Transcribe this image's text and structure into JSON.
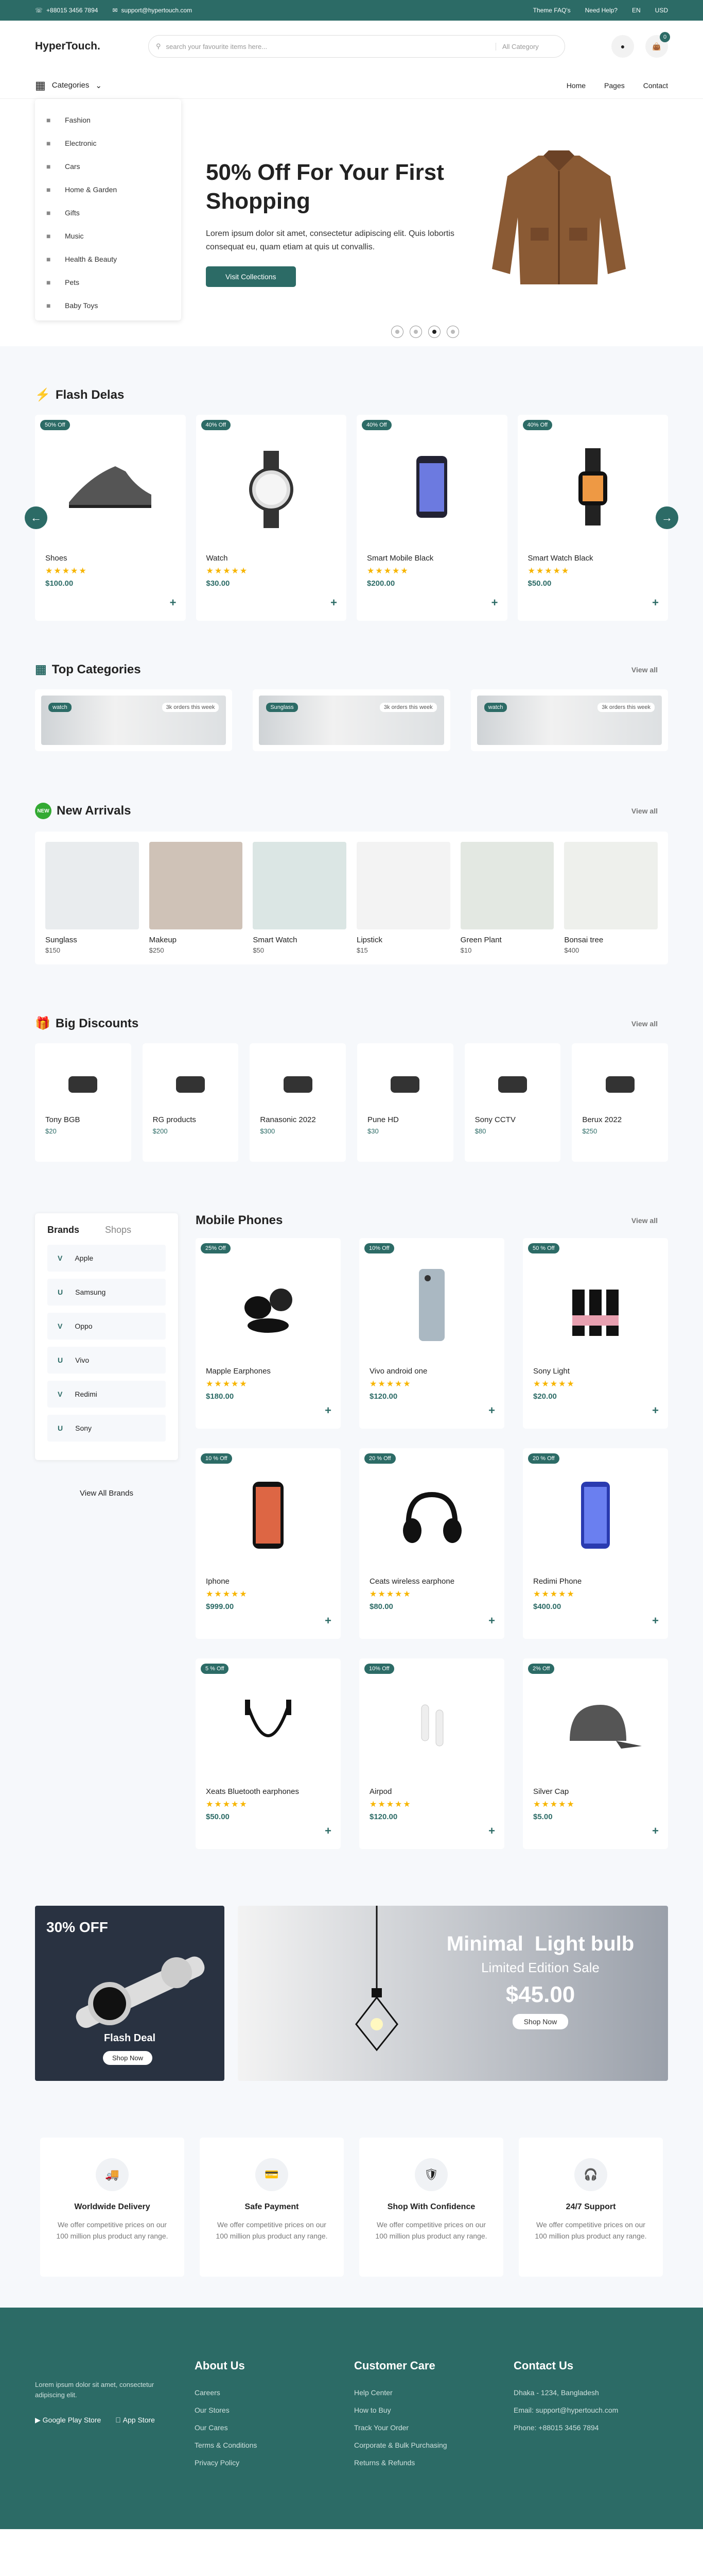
{
  "topbar": {
    "phone": "+88015 3456 7894",
    "email": "support@hypertouch.com",
    "faq": "Theme FAQ's",
    "help": "Need Help?",
    "lang": "EN",
    "currency": "USD"
  },
  "header": {
    "logo": "HyperTouch.",
    "search_placeholder": "search your favourite items here...",
    "search_category": "All Category",
    "cart_count": "0"
  },
  "nav": {
    "categories": "Categories",
    "links": [
      "Home",
      "Pages",
      "Contact"
    ]
  },
  "categories": [
    {
      "label": "Fashion",
      "icon": "shirt-icon"
    },
    {
      "label": "Electronic",
      "icon": "electronics-icon"
    },
    {
      "label": "Cars",
      "icon": "car-icon"
    },
    {
      "label": "Home & Garden",
      "icon": "home-icon"
    },
    {
      "label": "Gifts",
      "icon": "gift-icon"
    },
    {
      "label": "Music",
      "icon": "music-icon"
    },
    {
      "label": "Health & Beauty",
      "icon": "beauty-icon"
    },
    {
      "label": "Pets",
      "icon": "pet-icon"
    },
    {
      "label": "Baby Toys",
      "icon": "toy-icon"
    }
  ],
  "hero": {
    "title": "50% Off For Your First Shopping",
    "text": "Lorem ipsum dolor sit amet, consectetur adipiscing elit. Quis lobortis consequat eu, quam etiam at quis ut convallis.",
    "button": "Visit Collections",
    "active_slide": 3,
    "slides": 4
  },
  "flash": {
    "title": "Flash Delas",
    "items": [
      {
        "off": "50% Off",
        "name": "Shoes",
        "price": "$100.00",
        "img": "shoe"
      },
      {
        "off": "40% Off",
        "name": "Watch",
        "price": "$30.00",
        "img": "watch"
      },
      {
        "off": "40% Off",
        "name": "Smart Mobile Black",
        "price": "$200.00",
        "img": "phone"
      },
      {
        "off": "40% Off",
        "name": "Smart Watch Black",
        "price": "$50.00",
        "img": "smartwatch"
      }
    ]
  },
  "topcat": {
    "title": "Top Categories",
    "viewall": "View all",
    "items": [
      {
        "tag": "watch",
        "orders": "3k orders this week"
      },
      {
        "tag": "Sunglass",
        "orders": "3k orders this week"
      },
      {
        "tag": "watch",
        "orders": "3k orders this week"
      }
    ]
  },
  "arrivals": {
    "title": "New Arrivals",
    "viewall": "View all",
    "badge": "NEW",
    "items": [
      {
        "name": "Sunglass",
        "price": "$150"
      },
      {
        "name": "Makeup",
        "price": "$250"
      },
      {
        "name": "Smart Watch",
        "price": "$50"
      },
      {
        "name": "Lipstick",
        "price": "$15"
      },
      {
        "name": "Green Plant",
        "price": "$10"
      },
      {
        "name": "Bonsai tree",
        "price": "$400"
      }
    ]
  },
  "discounts": {
    "title": "Big Discounts",
    "viewall": "View all",
    "items": [
      {
        "name": "Tony BGB",
        "price": "$20"
      },
      {
        "name": "RG products",
        "price": "$200"
      },
      {
        "name": "Ranasonic 2022",
        "price": "$300"
      },
      {
        "name": "Pune HD",
        "price": "$30"
      },
      {
        "name": "Sony CCTV",
        "price": "$80"
      },
      {
        "name": "Berux 2022",
        "price": "$250"
      }
    ]
  },
  "brands": {
    "tab1": "Brands",
    "tab2": "Shops",
    "items": [
      "Apple",
      "Samsung",
      "Oppo",
      "Vivo",
      "Redimi",
      "Sony"
    ],
    "viewall": "View All Brands"
  },
  "mobile": {
    "title": "Mobile Phones",
    "viewall": "View all",
    "items": [
      {
        "off": "25% Off",
        "name": "Mapple Earphones",
        "price": "$180.00",
        "img": "earbuds"
      },
      {
        "off": "10% Off",
        "name": "Vivo android one",
        "price": "$120.00",
        "img": "silverphone"
      },
      {
        "off": "50 % Off",
        "name": "Sony Light",
        "price": "$20.00",
        "img": "bottles"
      },
      {
        "off": "10 % Off",
        "name": "Iphone",
        "price": "$999.00",
        "img": "iphone"
      },
      {
        "off": "20 % Off",
        "name": "Ceats wireless earphone",
        "price": "$80.00",
        "img": "earbuds2"
      },
      {
        "off": "20 % Off",
        "name": "Redimi Phone",
        "price": "$400.00",
        "img": "bluephone"
      },
      {
        "off": "5 % Off",
        "name": "Xeats Bluetooth earphones",
        "price": "$50.00",
        "img": "neckband"
      },
      {
        "off": "10% Off",
        "name": "Airpod",
        "price": "$120.00",
        "img": "airpod"
      },
      {
        "off": "2% Off",
        "name": "Silver Cap",
        "price": "$5.00",
        "img": "cap"
      }
    ]
  },
  "promo1": {
    "off": "30% OFF",
    "title": "Flash Deal",
    "button": "Shop Now"
  },
  "promo2": {
    "title": "Minimal  Light bulb",
    "subtitle": "Limited Edition Sale",
    "price": "$45.00",
    "button": "Shop Now"
  },
  "features": [
    {
      "title": "Worldwide Delivery",
      "text": "We offer competitive prices on our 100 million plus product any range.",
      "icon": "truck-icon"
    },
    {
      "title": "Safe Payment",
      "text": "We offer competitive prices on our 100 million plus product any range.",
      "icon": "card-icon"
    },
    {
      "title": "Shop With Confidence",
      "text": "We offer competitive prices on our 100 million plus product any range.",
      "icon": "shield-icon"
    },
    {
      "title": "24/7 Support",
      "text": "We offer competitive prices on our 100 million plus product any range.",
      "icon": "headset-icon"
    }
  ],
  "footer": {
    "about_text": "Lorem ipsum dolor sit amet, consectetur adipiscing elit.",
    "google": "Google Play Store",
    "apple": "App Store",
    "col1": {
      "title": "About Us",
      "links": [
        "Careers",
        "Our Stores",
        "Our Cares",
        "Terms & Conditions",
        "Privacy Policy"
      ]
    },
    "col2": {
      "title": "Customer Care",
      "links": [
        "Help Center",
        "How to Buy",
        "Track Your Order",
        "Corporate & Bulk Purchasing",
        "Returns & Refunds"
      ]
    },
    "col3": {
      "title": "Contact Us",
      "links": [
        "Dhaka - 1234, Bangladesh",
        "Email: support@hypertouch.com",
        "Phone: +88015 3456 7894"
      ]
    }
  },
  "colors": {
    "accent": "#2c6b66",
    "star": "#f7b500",
    "section_bg": "#f6f8fb"
  }
}
